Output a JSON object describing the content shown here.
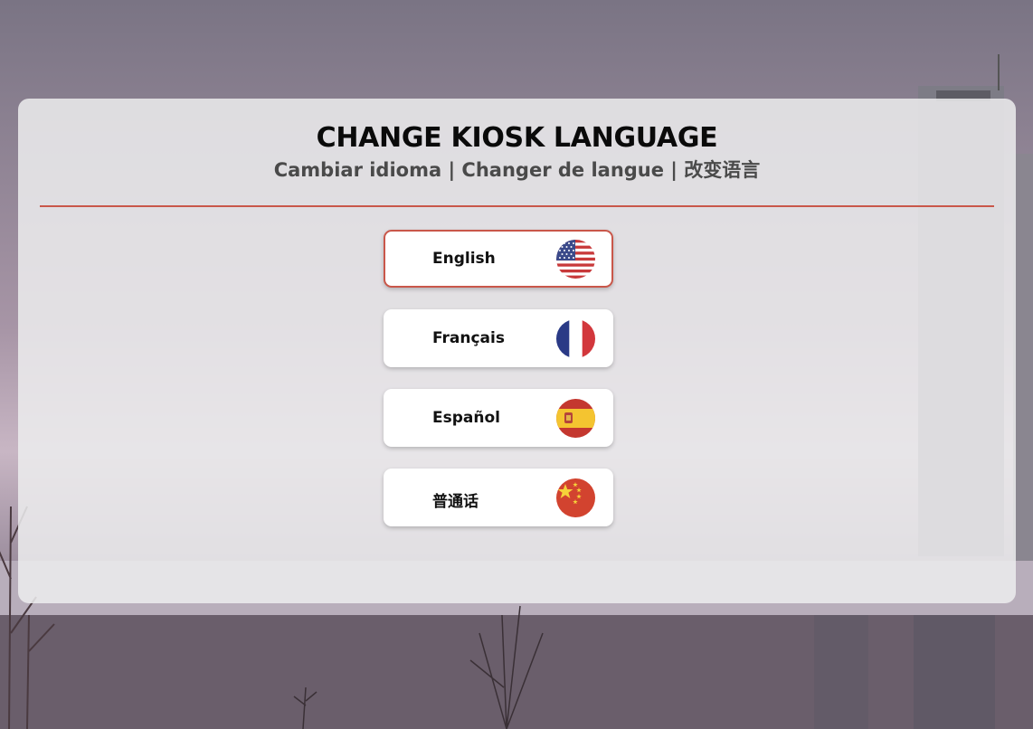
{
  "header": {
    "title": "CHANGE KIOSK LANGUAGE",
    "subtitle": "Cambiar idioma | Changer de langue | 改变语言"
  },
  "languages": [
    {
      "label": "English",
      "icon": "us-flag-icon",
      "selected": true
    },
    {
      "label": "Français",
      "icon": "france-flag-icon",
      "selected": false
    },
    {
      "label": "Español",
      "icon": "spain-flag-icon",
      "selected": false
    },
    {
      "label": "普通话",
      "icon": "china-flag-icon",
      "selected": false
    }
  ],
  "colors": {
    "accent": "#c9574a",
    "panel": "#ececee",
    "title": "#0a0a0a",
    "subtitle": "#4a4a4a"
  }
}
